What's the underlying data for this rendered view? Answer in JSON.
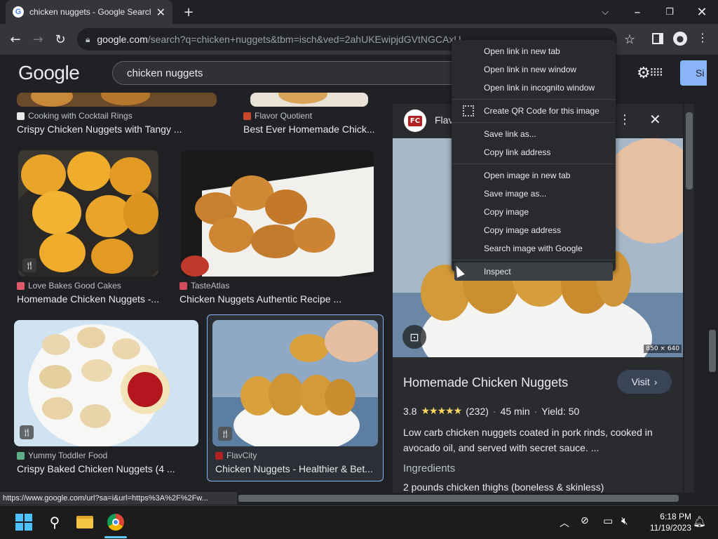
{
  "browser": {
    "tab_title": "chicken nuggets - Google Search",
    "tab_close": "✕",
    "new_tab": "+",
    "url_domain": "google.com",
    "url_rest": "/search?q=chicken+nuggets&tbm=isch&ved=2ahUKEwipjdGVtNGCAxU...",
    "status_url": "https://www.google.com/url?sa=i&url=https%3A%2F%2Fw..."
  },
  "google": {
    "logo": "Google",
    "search_value": "chicken nuggets",
    "signin_label": "Si"
  },
  "results": [
    {
      "source": "Cooking with Cocktail Rings",
      "title": "Crispy Chicken Nuggets with Tangy ...",
      "fav_color": "#e8e8e8"
    },
    {
      "source": "Flavor Quotient",
      "title": "Best Ever Homemade Chick...",
      "fav_color": "#c9482c"
    },
    {
      "source": "Love Bakes Good Cakes",
      "title": "Homemade Chicken Nuggets -...",
      "fav_color": "#e05a6a"
    },
    {
      "source": "TasteAtlas",
      "title": "Chicken Nuggets Authentic Recipe ...",
      "fav_color": "#d24b5a"
    },
    {
      "source": "Yummy Toddler Food",
      "title": "Crispy Baked Chicken Nuggets (4 ...",
      "fav_color": "#5fb08a"
    },
    {
      "source": "FlavCity",
      "title": "Chicken Nuggets - Healthier & Bet...",
      "fav_color": "#b22222"
    }
  ],
  "panel": {
    "site_name": "Flav",
    "site_logo": "FC",
    "image_size": "850 × 640",
    "title": "Homemade Chicken Nuggets",
    "visit_label": "Visit",
    "rating": "3.8",
    "stars": "★★★★★",
    "reviews": "(232)",
    "time": "45 min",
    "yield": "Yield: 50",
    "description": "Low carb chicken nuggets coated in pork rinds, cooked in avocado oil, and served with secret sauce. ...",
    "ingredients_heading": "Ingredients",
    "ingredient_1": "2 pounds chicken thighs (boneless & skinless)"
  },
  "context_menu": {
    "items": [
      "Open link in new tab",
      "Open link in new window",
      "Open link in incognito window",
      "Create QR Code for this image",
      "Save link as...",
      "Copy link address",
      "Open image in new tab",
      "Save image as...",
      "Copy image",
      "Copy image address",
      "Search image with Google",
      "Inspect"
    ]
  },
  "taskbar": {
    "time": "6:18 PM",
    "date": "11/19/2023"
  },
  "colors": {
    "accent": "#8ab4f8",
    "star": "#fdd663",
    "background": "#202124"
  }
}
